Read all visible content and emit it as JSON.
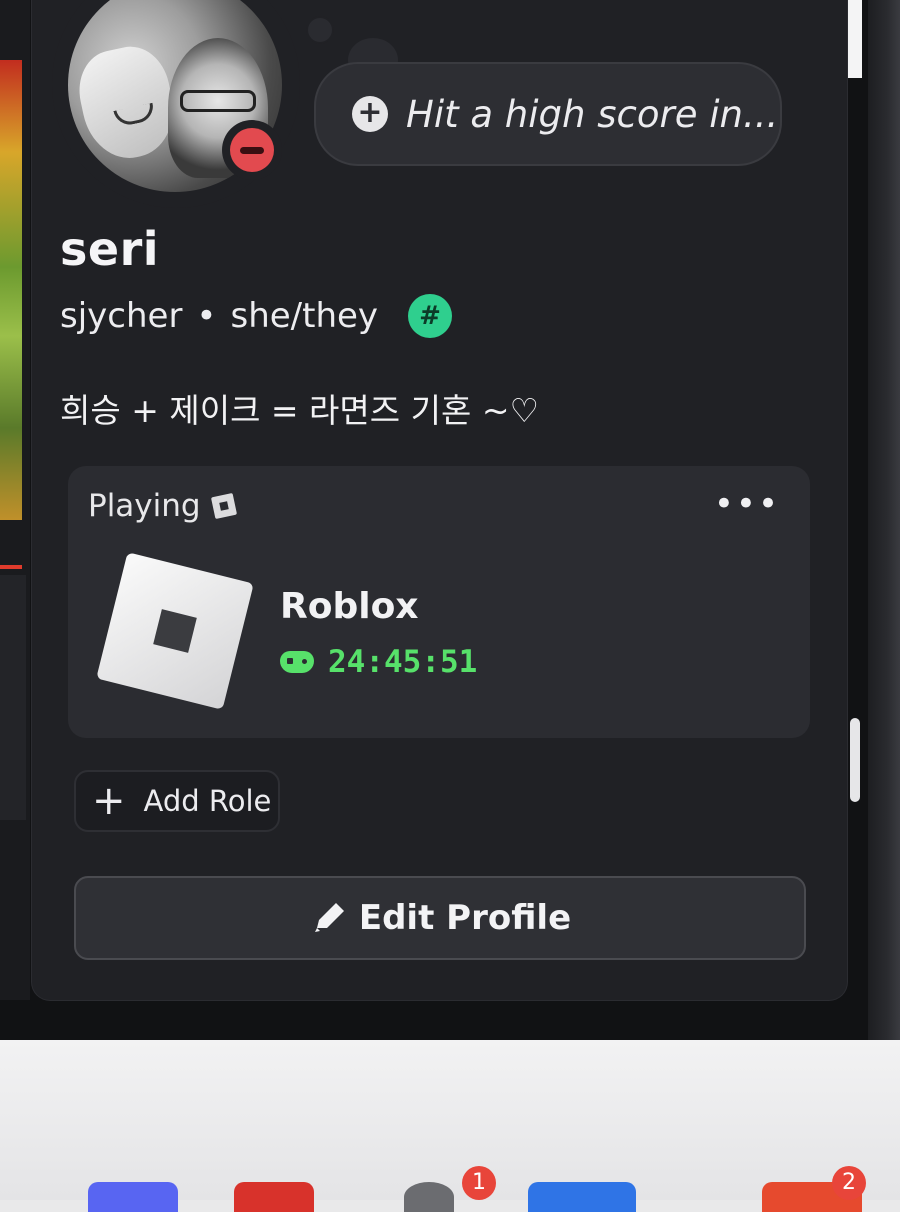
{
  "profile": {
    "status_message": "Hit a high score in...",
    "display_name": "seri",
    "username": "sjycher",
    "separator": "•",
    "pronouns": "she/they",
    "badge_symbol": "#",
    "bio": "희승 + 제이크 = 라면즈 기혼 ~♡",
    "presence": "do-not-disturb"
  },
  "activity": {
    "header": "Playing",
    "more_label": "•••",
    "game_name": "Roblox",
    "elapsed": "24:45:51",
    "elapsed_icon": "gamepad-icon",
    "elapsed_color": "#57e16a"
  },
  "actions": {
    "add_role_label": "Add Role",
    "add_role_icon": "plus-icon",
    "edit_profile_label": "Edit Profile",
    "edit_profile_icon": "pencil-icon"
  },
  "taskbar": {
    "badges": [
      "1",
      "2"
    ]
  },
  "colors": {
    "card_bg": "#202125",
    "activity_bg": "#2b2c31",
    "dnd_red": "#e24a4f",
    "badge_green": "#2fcf8e"
  }
}
